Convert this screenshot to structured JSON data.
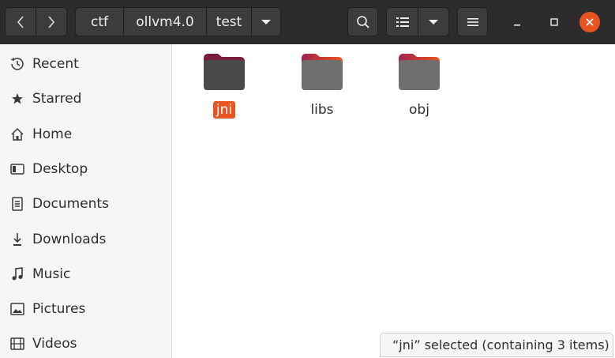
{
  "breadcrumb": [
    "ctf",
    "ollvm4.0",
    "test"
  ],
  "sidebar": {
    "items": [
      {
        "label": "Recent",
        "icon": "clock-icon"
      },
      {
        "label": "Starred",
        "icon": "star-icon"
      },
      {
        "label": "Home",
        "icon": "home-icon"
      },
      {
        "label": "Desktop",
        "icon": "desktop-icon"
      },
      {
        "label": "Documents",
        "icon": "document-icon"
      },
      {
        "label": "Downloads",
        "icon": "download-icon"
      },
      {
        "label": "Music",
        "icon": "music-icon"
      },
      {
        "label": "Pictures",
        "icon": "picture-icon"
      },
      {
        "label": "Videos",
        "icon": "video-icon"
      }
    ]
  },
  "files": [
    {
      "name": "jni",
      "selected": true
    },
    {
      "name": "libs",
      "selected": false
    },
    {
      "name": "obj",
      "selected": false
    }
  ],
  "status": {
    "text": "“jni” selected  (containing 3 items)"
  },
  "colors": {
    "accent": "#e95420",
    "headerbar": "#2c2c2c",
    "folder_tab": "#a2224f",
    "folder_body_selected": "#4a4a4a",
    "folder_body": "#6f6f6f"
  }
}
